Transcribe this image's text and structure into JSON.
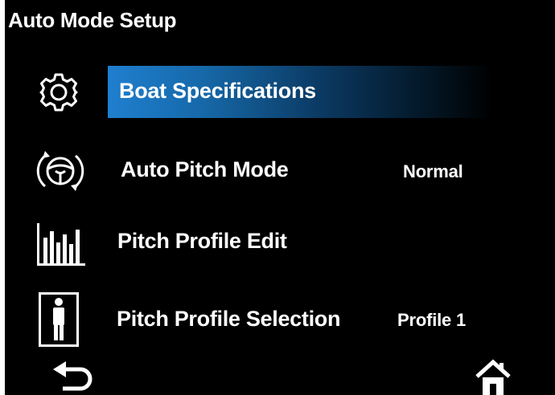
{
  "header": {
    "title": "Auto Mode Setup"
  },
  "menu": {
    "items": [
      {
        "label": "Boat Specifications",
        "value": "",
        "icon": "gear-icon",
        "selected": true
      },
      {
        "label": "Auto Pitch Mode",
        "value": "Normal",
        "icon": "steering-wheel-icon",
        "selected": false
      },
      {
        "label": "Pitch Profile Edit",
        "value": "",
        "icon": "bar-chart-icon",
        "selected": false
      },
      {
        "label": "Pitch Profile Selection",
        "value": "Profile 1",
        "icon": "person-icon",
        "selected": false
      }
    ]
  },
  "footer": {
    "back_icon": "back-arrow-icon",
    "home_icon": "home-icon"
  },
  "colors": {
    "background": "#000000",
    "text": "#ffffff",
    "highlight": "#1f7fcf"
  }
}
